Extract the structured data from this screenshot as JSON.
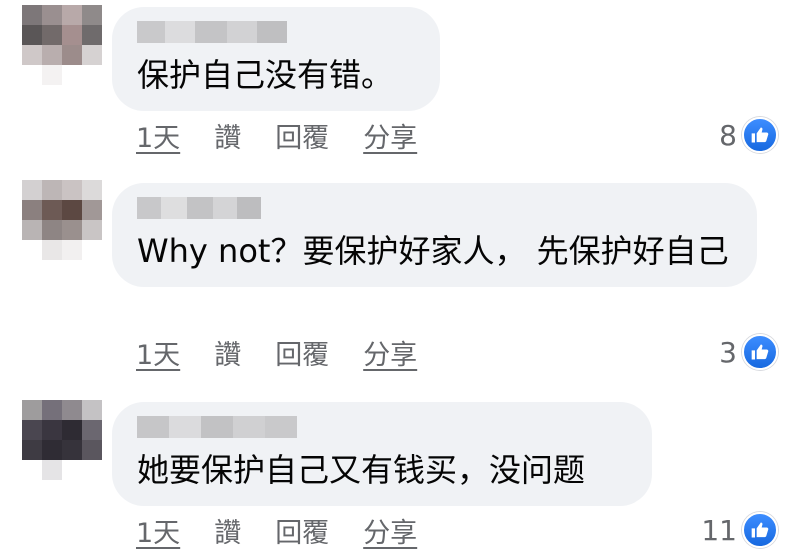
{
  "comments": [
    {
      "text": "保护自己没有错。",
      "actions": {
        "time": "1天",
        "like": "讚",
        "reply": "回覆",
        "share": "分享"
      },
      "reaction_count": "8"
    },
    {
      "text": "Why not？要保护好家人， 先保护好自己",
      "actions": {
        "time": "1天",
        "like": "讚",
        "reply": "回覆",
        "share": "分享"
      },
      "reaction_count": "3"
    },
    {
      "text": "她要保护自己又有钱买，没问题",
      "actions": {
        "time": "1天",
        "like": "讚",
        "reply": "回覆",
        "share": "分享"
      },
      "reaction_count": "11"
    }
  ],
  "icons": {
    "reaction": "thumbs-up-icon"
  },
  "colors": {
    "bubble": "#f0f2f5",
    "like_blue": "#1877f2",
    "meta_gray": "#65676b"
  }
}
